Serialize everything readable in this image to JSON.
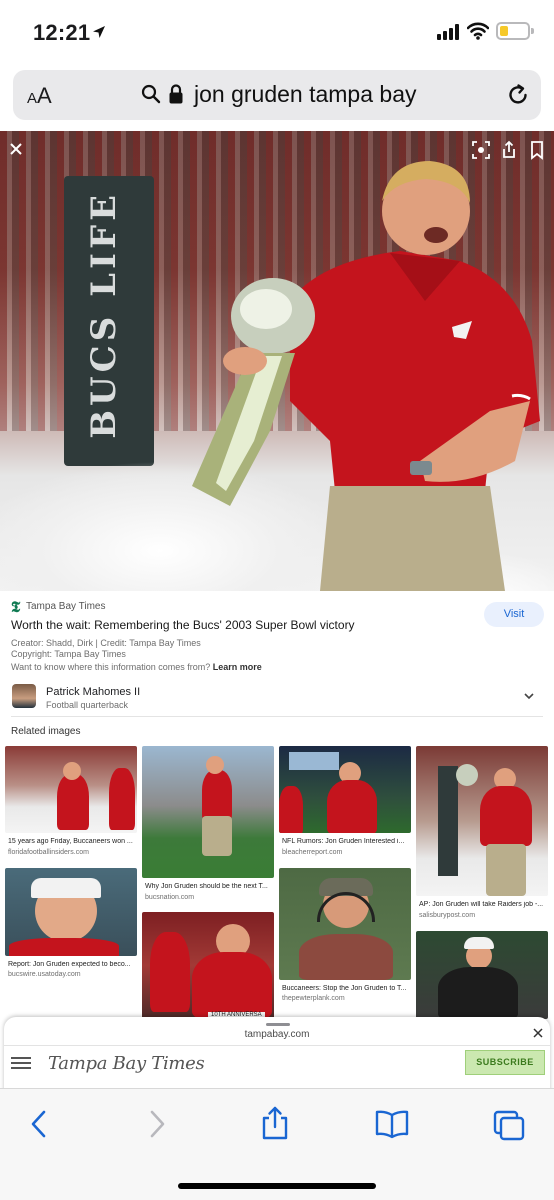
{
  "status_bar": {
    "time": "12:21",
    "battery_level": 0.3,
    "battery_color": "#f6c929"
  },
  "address_bar": {
    "text_size_label": "AA",
    "query": "jon gruden tampa bay"
  },
  "hero": {
    "banner_text": "BUCS LIFE"
  },
  "source": {
    "publisher": "Tampa Bay Times",
    "title": "Worth the wait: Remembering the Bucs' 2003 Super Bowl victory",
    "visit_label": "Visit",
    "creator_line": "Creator: Shadd, Dirk | Credit: Tampa Bay Times",
    "copyright_line": "Copyright: Tampa Bay Times",
    "info_question": "Want to know where this information comes from?",
    "learn_more": "Learn more"
  },
  "person": {
    "name": "Patrick Mahomes II",
    "role": "Football quarterback"
  },
  "related": {
    "heading": "Related images",
    "items": [
      {
        "caption": "15 years ago Friday, Buccaneers won ...",
        "domain": "floridafootballinsiders.com"
      },
      {
        "caption": "Why Jon Gruden should be the next T...",
        "domain": "bucsnation.com"
      },
      {
        "caption": "NFL Rumors: Jon Gruden Interested i...",
        "domain": "bleacherreport.com"
      },
      {
        "caption": "AP: Jon Gruden will take Raiders job -...",
        "domain": "salisburypost.com"
      },
      {
        "caption": "Report: Jon Gruden expected to beco...",
        "domain": "bucswire.usatoday.com"
      },
      {
        "caption": "Buccaneers: Stop the Jon Gruden to T...",
        "domain": "thepewterplank.com"
      }
    ],
    "partial_label": "10TH ANNIVERSA"
  },
  "sheet": {
    "domain": "tampabay.com",
    "masthead": "Tampa Bay Times",
    "subscribe_label": "SUBSCRIBE"
  },
  "colors": {
    "accent": "#1a66d2",
    "brand_red": "#c8232c",
    "subscribe_green": "#cbe8b0"
  }
}
